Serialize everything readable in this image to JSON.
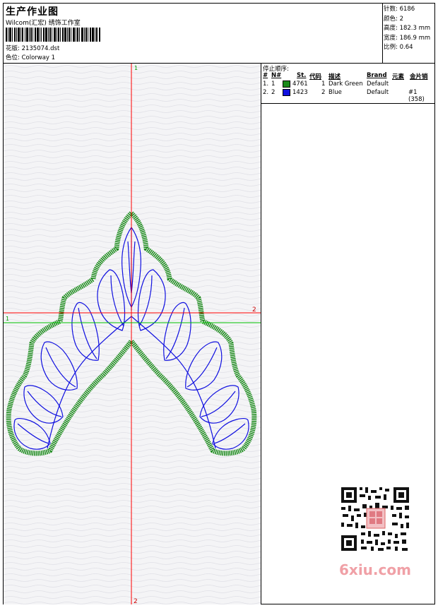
{
  "header": {
    "title": "生产作业图",
    "company": "Wilcom(汇宏) 绣饰工作室",
    "design_label": "花版:",
    "design_value": "2135074.dst",
    "colorway_label": "色位:",
    "colorway_value": "Colorway 1"
  },
  "stats": {
    "stitches": {
      "label": "针数:",
      "value": "6186"
    },
    "colors": {
      "label": "颜色:",
      "value": "2"
    },
    "height": {
      "label": "高度:",
      "value": "182.3 mm"
    },
    "width": {
      "label": "宽度:",
      "value": "186.9 mm"
    },
    "scale": {
      "label": "比例:",
      "value": "0.64"
    }
  },
  "stop_sequence": {
    "title": "停止顺序:",
    "headers": {
      "num": "#",
      "n": "N#",
      "st": "St.",
      "code": "代码",
      "desc": "描述",
      "brand": "Brand",
      "element": "元素",
      "sequin": "金片销"
    },
    "rows": [
      {
        "num": "1.",
        "n": "1",
        "color": "#1a8a1a",
        "st": "4761",
        "code": "1",
        "desc": "Dark Green",
        "brand": "Default",
        "element": "",
        "sequin": ""
      },
      {
        "num": "2.",
        "n": "2",
        "color": "#1010e0",
        "st": "1423",
        "code": "2",
        "desc": "Blue",
        "brand": "Default",
        "element": "",
        "sequin": "#1 (358)"
      }
    ]
  },
  "axis_labels": {
    "top": "1",
    "bottom": "2",
    "left": "1",
    "right": "2"
  },
  "watermark": "6xiu.com",
  "colors": {
    "green": "#1a8a1a",
    "blue": "#1010e0",
    "crosshair_red": "#ff0000",
    "crosshair_green": "#00c000"
  }
}
